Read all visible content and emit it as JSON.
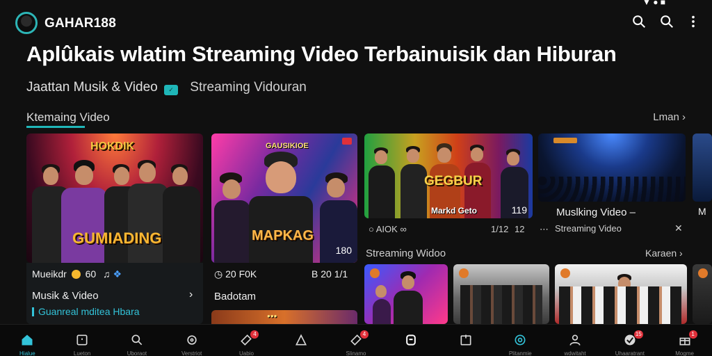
{
  "app": {
    "name": "GAHAR188"
  },
  "page": {
    "title": "Aplûkais wlatim Streaming Video Terbainuisik dan Hiburan",
    "subtitle_primary": "Jaattan Musik & Video",
    "subtitle_secondary": "Streaming Vidouran"
  },
  "section1": {
    "tab_label": "Ktemaing Video",
    "see_all": "Lman"
  },
  "cards": [
    {
      "thumb_text": "GUMIADING",
      "thumb_top_text": "HOKDIK",
      "title": "Mueikdr",
      "stats": "60",
      "subtitle": "Musik & Video",
      "link": "Guanreal mditea Hbara"
    },
    {
      "thumb_text": "MAPKAG",
      "thumb_top_text": "GAUSIKIOE",
      "counter": "180",
      "stats_left": "20 F0K",
      "stats_right": "B 20 1/1",
      "subtitle": "Badotam"
    },
    {
      "thumb_text": "GEGBUR",
      "thumb_sub_text": "Markd Geto",
      "counter": "119",
      "stats_left": "AIOK",
      "stats_right": "1/12",
      "stats_right2": "12"
    },
    {
      "title": "Muslking Video –",
      "subtitle": "Streaming Video"
    }
  ],
  "section2": {
    "label": "Streaming Widoo",
    "see_all": "Karaen"
  },
  "bottom_nav": [
    {
      "label": "Hialue",
      "icon": "home-icon",
      "active": true
    },
    {
      "label": "Lueton",
      "icon": "square-icon"
    },
    {
      "label": "Uboraot",
      "icon": "search-icon"
    },
    {
      "label": "Verstriot",
      "icon": "circle-arrows-icon"
    },
    {
      "label": "Uabio",
      "icon": "tag-icon",
      "badge": "4"
    },
    {
      "label": "",
      "icon": "triangle-icon"
    },
    {
      "label": "Slinamo",
      "icon": "tag-icon",
      "badge": "4"
    },
    {
      "label": "",
      "icon": "rounded-square-icon"
    },
    {
      "label": "",
      "icon": "frame-icon"
    },
    {
      "label": "Plitanmie",
      "icon": "target-icon"
    },
    {
      "label": "wdwitaht",
      "icon": "user-icon"
    },
    {
      "label": "Uhaaratrant",
      "icon": "check-circle-icon",
      "badge": "15"
    },
    {
      "label": "Mogme",
      "icon": "gift-icon",
      "badge": "1"
    }
  ],
  "colors": {
    "accent": "#1fb6b8",
    "link": "#33c3d9",
    "badge": "#e0303a",
    "background": "#101010"
  }
}
